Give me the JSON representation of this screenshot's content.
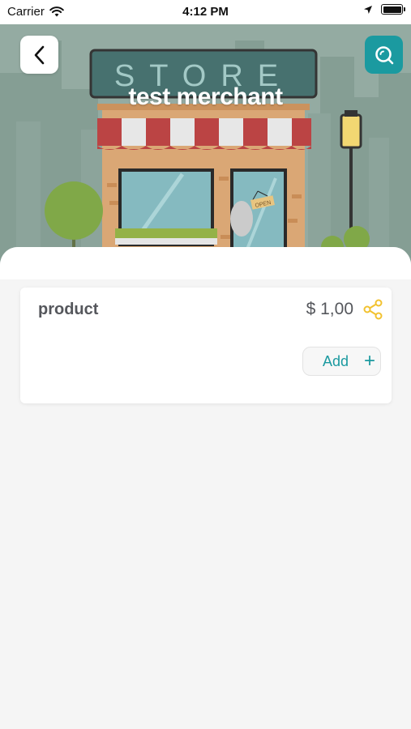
{
  "status_bar": {
    "carrier": "Carrier",
    "time": "4:12 PM",
    "icons": [
      "wifi-icon",
      "location-arrow-icon",
      "battery-icon"
    ]
  },
  "header": {
    "merchant_name": "test merchant",
    "store_sign": "STORE",
    "door_sign": "OPEN",
    "back_icon": "chevron-left-icon",
    "search_icon": "search-icon"
  },
  "products": [
    {
      "name": "product",
      "price": "$ 1,00",
      "add_label": "Add",
      "add_symbol": "+",
      "share_icon": "share-icon"
    }
  ],
  "colors": {
    "accent": "#1b9aa0",
    "share": "#f2c230",
    "text": "#55575c",
    "background": "#f5f5f5"
  }
}
